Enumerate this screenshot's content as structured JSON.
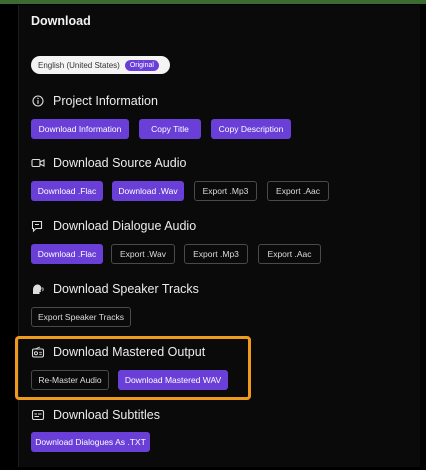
{
  "panel": {
    "title": "Download"
  },
  "language": {
    "name": "English (United States)",
    "badge": "Original"
  },
  "sections": [
    {
      "title": "Project Information",
      "icon": "info-icon",
      "buttons": [
        {
          "label": "Download Information",
          "style": "primary"
        },
        {
          "label": "Copy Title",
          "style": "primary"
        },
        {
          "label": "Copy Description",
          "style": "primary"
        }
      ]
    },
    {
      "title": "Download Source Audio",
      "icon": "video-camera-icon",
      "buttons": [
        {
          "label": "Download .Flac",
          "style": "primary"
        },
        {
          "label": "Download .Wav",
          "style": "primary"
        },
        {
          "label": "Export .Mp3",
          "style": "outline"
        },
        {
          "label": "Export .Aac",
          "style": "outline"
        }
      ]
    },
    {
      "title": "Download Dialogue Audio",
      "icon": "chat-bubble-icon",
      "buttons": [
        {
          "label": "Download .Flac",
          "style": "primary"
        },
        {
          "label": "Export .Wav",
          "style": "outline"
        },
        {
          "label": "Export .Mp3",
          "style": "outline"
        },
        {
          "label": "Export .Aac",
          "style": "outline"
        }
      ]
    },
    {
      "title": "Download Speaker Tracks",
      "icon": "speaker-head-icon",
      "buttons": [
        {
          "label": "Export Speaker Tracks",
          "style": "outline"
        }
      ]
    },
    {
      "title": "Download Mastered Output",
      "icon": "radio-icon",
      "buttons": [
        {
          "label": "Re-Master Audio",
          "style": "outline"
        },
        {
          "label": "Download Mastered WAV",
          "style": "primary"
        }
      ]
    },
    {
      "title": "Download Subtitles",
      "icon": "subtitles-icon",
      "buttons": [
        {
          "label": "Download Dialogues As .TXT",
          "style": "primary"
        }
      ]
    }
  ],
  "colors": {
    "accent": "#6a3fd8",
    "highlight": "#f09a1c",
    "background": "#0a0a0a"
  }
}
